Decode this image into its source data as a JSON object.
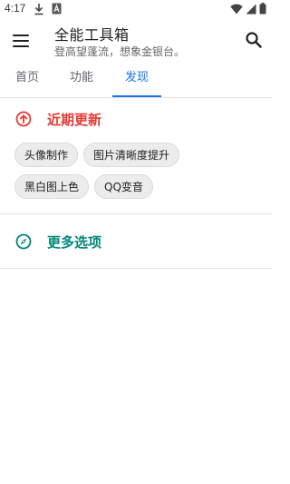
{
  "status_bar": {
    "time": "4:17",
    "icons": [
      "download-icon",
      "a-notification-icon",
      "wifi-icon",
      "signal-icon",
      "battery-icon"
    ]
  },
  "app_bar": {
    "title": "全能工具箱",
    "subtitle": "登高望蓬流，想象金银台。",
    "icons": [
      "menu-icon",
      "search-icon"
    ]
  },
  "tabs": [
    {
      "label": "首页",
      "active": false
    },
    {
      "label": "功能",
      "active": false
    },
    {
      "label": "发现",
      "active": true
    }
  ],
  "recent_section": {
    "title": "近期更新",
    "icon": "arrow-up-circle-icon",
    "chips": [
      "头像制作",
      "图片清晰度提升",
      "黑白图上色",
      "QQ变音"
    ]
  },
  "more_section": {
    "title": "更多选项",
    "icon": "compass-icon"
  },
  "colors": {
    "accent_blue": "#1a73e8",
    "recent_red": "#e53935",
    "more_teal": "#00897b"
  }
}
